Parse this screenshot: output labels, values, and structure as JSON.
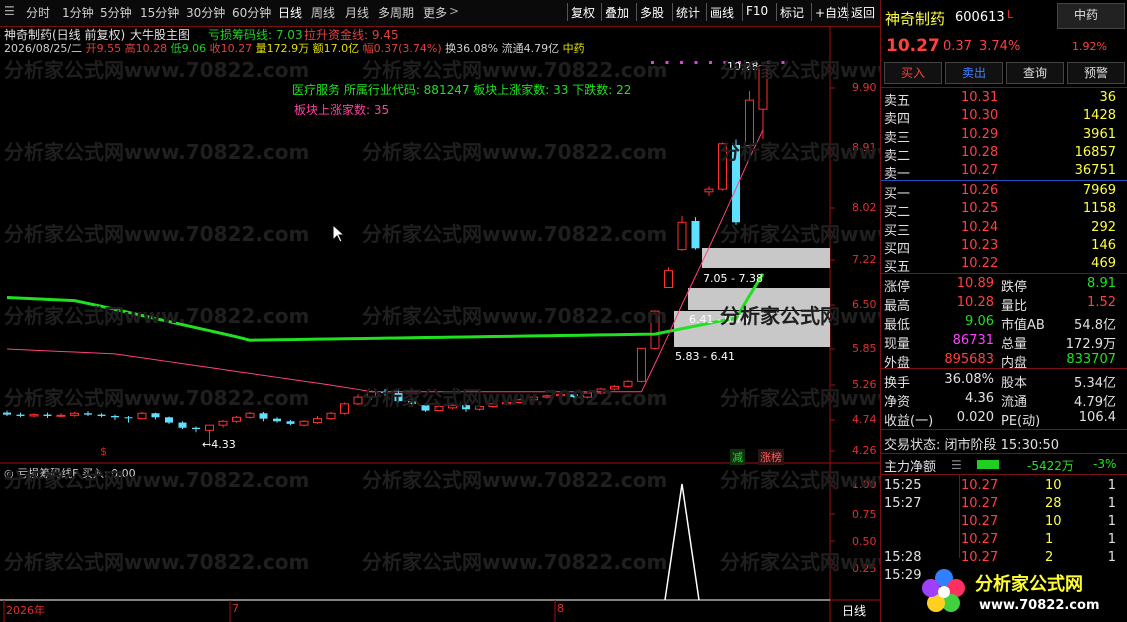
{
  "toolbar": {
    "left_items": [
      "分时",
      "1分钟",
      "5分钟",
      "15分钟",
      "30分钟",
      "60分钟",
      "日线",
      "周线",
      "月线",
      "多周期",
      "更多"
    ],
    "active_item": "日线",
    "right_items": [
      "复权",
      "叠加",
      "多股",
      "统计",
      "画线",
      "F10",
      "标记",
      "+自选",
      "返回"
    ]
  },
  "chart_header": {
    "title": "神奇制药(日线 前复权)",
    "indicator_name": "大牛股主图",
    "ind1": "亏损筹码线: 7.03",
    "ind2": "拉升资金线: 9.45",
    "ohlc_line": {
      "date": "2026/08/25/二",
      "open": "开9.55",
      "high": "高10.28",
      "low": "低9.06",
      "close": "收10.27",
      "volume": "量172.9万",
      "amount": "额17.0亿",
      "change": "幅0.37(3.74%)",
      "turnover": "换36.08%",
      "float": "流通4.79亿",
      "tag": "中药"
    },
    "sector_line": "医疗服务  所属行业代码: 881247 板块上涨家数: 33 下跌数: 22",
    "sector_line2": "板块上涨家数: 35"
  },
  "price_axis": [
    "9.90",
    "8.91",
    "8.02",
    "7.22",
    "6.50",
    "5.85",
    "5.26",
    "4.74",
    "4.26"
  ],
  "lower_axis": [
    "1.00",
    "0.75",
    "0.50",
    "0.25"
  ],
  "annotations": {
    "high_label": "10.28",
    "low_label": "4.33",
    "box1": "7.05 - 7.38",
    "box2": "6.41 - 6.78",
    "box3": "5.83 - 6.41",
    "dollar": "$",
    "tag_reduce": "减",
    "tag_limit": "涨榜"
  },
  "lower_panel": {
    "title": "亏损筹码线F",
    "buy_label": "买入: 0.00"
  },
  "x_axis": {
    "labels": [
      "2026年",
      "7",
      "8"
    ],
    "period": "日线"
  },
  "chart_data": {
    "type": "table",
    "title": "神奇制药(日线 前复权)",
    "price_ticks": [
      9.9,
      8.91,
      8.02,
      7.22,
      6.5,
      5.85,
      5.26,
      4.74,
      4.26
    ],
    "indicator_ticks": [
      1.0,
      0.75,
      0.5,
      0.25
    ]
  },
  "stock": {
    "name": "神奇制药",
    "code": "600613",
    "code_flag": "L",
    "sector_tag": "中药",
    "sector_pct": "1.92%",
    "price": "10.27",
    "change": "0.37",
    "pct": "3.74%"
  },
  "trade_buttons": [
    "买入",
    "卖出",
    "查询",
    "预警"
  ],
  "asks": [
    {
      "label": "卖五",
      "price": "10.31",
      "vol": "36"
    },
    {
      "label": "卖四",
      "price": "10.30",
      "vol": "1428"
    },
    {
      "label": "卖三",
      "price": "10.29",
      "vol": "3961"
    },
    {
      "label": "卖二",
      "price": "10.28",
      "vol": "16857"
    },
    {
      "label": "卖一",
      "price": "10.27",
      "vol": "36751"
    }
  ],
  "bids": [
    {
      "label": "买一",
      "price": "10.26",
      "vol": "7969"
    },
    {
      "label": "买二",
      "price": "10.25",
      "vol": "1158"
    },
    {
      "label": "买三",
      "price": "10.24",
      "vol": "292"
    },
    {
      "label": "买四",
      "price": "10.23",
      "vol": "146"
    },
    {
      "label": "买五",
      "price": "10.22",
      "vol": "469"
    }
  ],
  "stats1": [
    {
      "k1": "涨停",
      "v1": "10.89",
      "k2": "跌停",
      "v2": "8.91"
    },
    {
      "k1": "最高",
      "v1": "10.28",
      "k2": "量比",
      "v2": "1.52"
    },
    {
      "k1": "最低",
      "v1": "9.06",
      "k2": "市值AB",
      "v2": "54.8亿"
    },
    {
      "k1": "现量",
      "v1": "86731",
      "k2": "总量",
      "v2": "172.9万"
    },
    {
      "k1": "外盘",
      "v1": "895683",
      "k2": "内盘",
      "v2": "833707"
    }
  ],
  "stats2": [
    {
      "k1": "换手",
      "v1": "36.08%",
      "k2": "股本",
      "v2": "5.34亿"
    },
    {
      "k1": "净资",
      "v1": "4.36",
      "k2": "流通",
      "v2": "4.79亿"
    },
    {
      "k1": "收益(一)",
      "v1": "0.020",
      "k2": "PE(动)",
      "v2": "106.4"
    }
  ],
  "trade_status": "交易状态: 闭市阶段 15:30:50",
  "main_flow": {
    "label": "主力净额",
    "value": "-5422万",
    "pct": "-3%"
  },
  "ticks": [
    {
      "time": "15:25",
      "price": "10.27",
      "vol": "10",
      "n": "1"
    },
    {
      "time": "15:27",
      "price": "10.27",
      "vol": "28",
      "n": "1"
    },
    {
      "time": "",
      "price": "10.27",
      "vol": "10",
      "n": "1"
    },
    {
      "time": "",
      "price": "10.27",
      "vol": "1",
      "n": "1"
    },
    {
      "time": "15:28",
      "price": "10.27",
      "vol": "2",
      "n": "1"
    },
    {
      "time": "15:29",
      "price": "",
      "vol": "",
      "n": ""
    }
  ],
  "watermark": "分析家公式网www.70822.com",
  "logo": {
    "text": "分析家公式网",
    "url": "www.70822.com"
  }
}
